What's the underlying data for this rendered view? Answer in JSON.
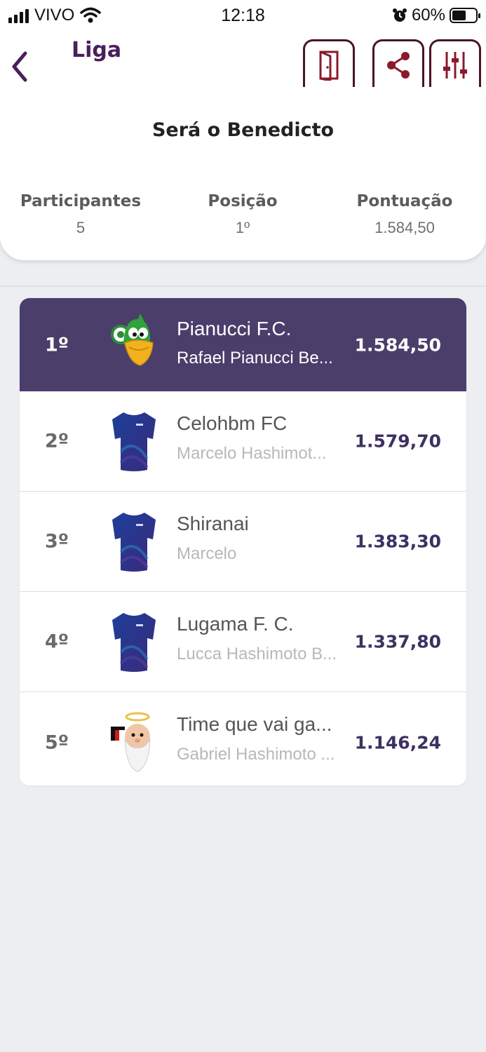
{
  "status_bar": {
    "carrier": "VIVO",
    "time": "12:18",
    "battery": "60%",
    "battery_level": 0.6
  },
  "nav": {
    "title": "Liga",
    "icons": [
      "chevron-left-icon",
      "exit-door-icon",
      "share-icon",
      "filter-sliders-icon"
    ]
  },
  "league": {
    "name": "Será o Benedicto",
    "stats": [
      {
        "label": "Participantes",
        "value": "5"
      },
      {
        "label": "Posição",
        "value": "1º"
      },
      {
        "label": "Pontuação",
        "value": "1.584,50"
      }
    ]
  },
  "ranking": [
    {
      "position": "1º",
      "team": "Pianucci F.C.",
      "owner": "Rafael Pianucci Be...",
      "score": "1.584,50",
      "avatar": "duck-mascot-icon"
    },
    {
      "position": "2º",
      "team": "Celohbm FC",
      "owner": "Marcelo Hashimot...",
      "score": "1.579,70",
      "avatar": "blue-jersey-icon"
    },
    {
      "position": "3º",
      "team": "Shiranai",
      "owner": "Marcelo",
      "score": "1.383,30",
      "avatar": "blue-jersey-icon"
    },
    {
      "position": "4º",
      "team": "Lugama F. C.",
      "owner": "Lucca Hashimoto B...",
      "score": "1.337,80",
      "avatar": "blue-jersey-icon"
    },
    {
      "position": "5º",
      "team": "Time que vai ga...",
      "owner": "Gabriel Hashimoto ...",
      "score": "1.146,24",
      "avatar": "saint-mascot-icon"
    }
  ],
  "colors": {
    "accent": "#4b3e6b",
    "title": "#4a1f5c",
    "icon": "#8b1a2b",
    "background": "#eceef2"
  }
}
